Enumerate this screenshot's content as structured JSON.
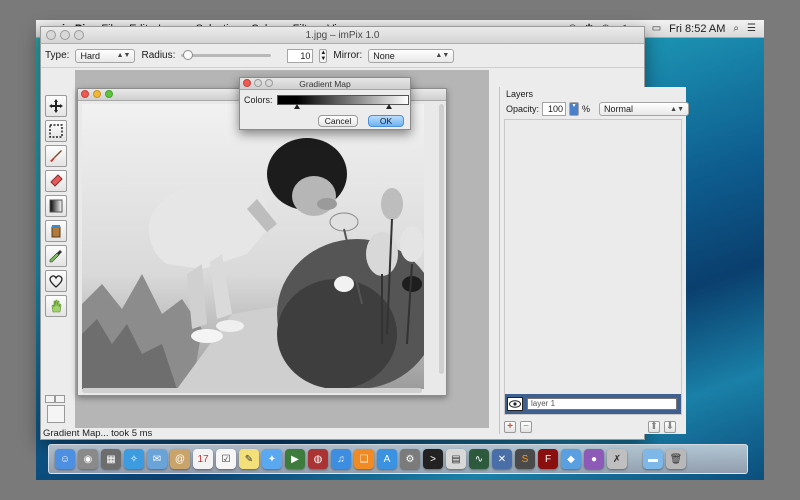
{
  "menubar": {
    "apple": "",
    "app_name": "imPix",
    "menus": [
      "File",
      "Edit",
      "Layer",
      "Selection",
      "Colors",
      "Filter",
      "View"
    ],
    "clock": "Fri 8:52 AM"
  },
  "window": {
    "title": "1.jpg – imPix 1.0"
  },
  "toolbar": {
    "type_label": "Type:",
    "type_value": "Hard",
    "radius_label": "Radius:",
    "radius_value": "10",
    "mirror_label": "Mirror:",
    "mirror_value": "None"
  },
  "dialog": {
    "title": "Gradient Map",
    "colors_label": "Colors:",
    "cancel_label": "Cancel",
    "ok_label": "OK"
  },
  "layers": {
    "title": "Layers",
    "opacity_label": "Opacity:",
    "opacity_value": "100",
    "percent": "%",
    "blend_mode": "Normal",
    "layer_name": "layer 1",
    "add_label": "+",
    "remove_label": "−"
  },
  "status": {
    "text": "Gradient Map... took 5 ms"
  },
  "colors": {
    "accent": "#3f5f8e",
    "ok_button": "#6fb4f3"
  },
  "tools": [
    "move-icon",
    "marquee-icon",
    "brush-icon",
    "eraser-icon",
    "gradient-icon",
    "bucket-icon",
    "eyedropper-icon",
    "heart-shape-icon",
    "hand-icon"
  ],
  "dock_icons": [
    "finder-icon",
    "launchpad-icon",
    "mission-control-icon",
    "safari-icon",
    "mail-icon",
    "contacts-icon",
    "calendar-icon",
    "reminders-icon",
    "notes-icon",
    "messages-icon",
    "facetime-icon",
    "photo-booth-icon",
    "itunes-icon",
    "ibooks-icon",
    "app-store-icon",
    "system-preferences-icon",
    "terminal-icon",
    "preview-icon",
    "activity-monitor-icon",
    "xcode-icon",
    "sublime-icon",
    "flash-icon",
    "impix-icon",
    "instruments-icon",
    "folder-icon",
    "trash-icon"
  ]
}
